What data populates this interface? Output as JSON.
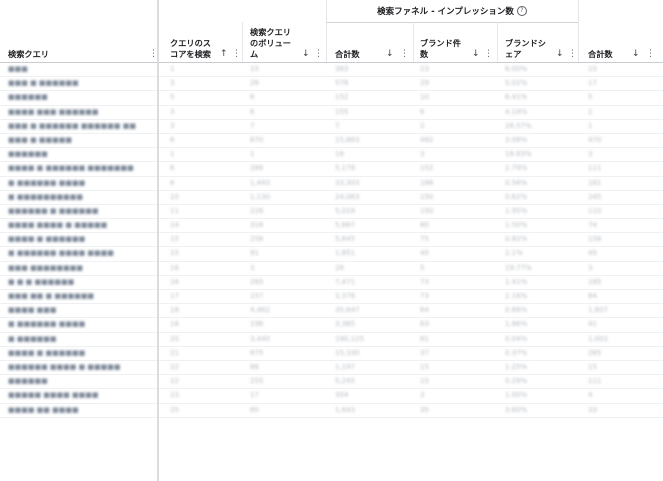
{
  "group_header": {
    "label": "検索ファネル - インプレッション数",
    "help": "?"
  },
  "columns": [
    {
      "label_lines": [
        "検索クエリ"
      ],
      "sort": "",
      "menu": "⋮"
    },
    {
      "label_lines": [
        "クエリのス",
        "コアを検索"
      ],
      "sort": "↑",
      "menu": "⋮"
    },
    {
      "label_lines": [
        "検索クエリ",
        "のボリュー",
        "ム"
      ],
      "sort": "↓",
      "menu": "⋮"
    },
    {
      "label_lines": [
        "合計数"
      ],
      "sort": "↓",
      "menu": "⋮"
    },
    {
      "label_lines": [
        "ブランド件",
        "数"
      ],
      "sort": "↓",
      "menu": "⋮"
    },
    {
      "label_lines": [
        "ブランドシ",
        "ェア"
      ],
      "sort": "↓",
      "menu": "⋮"
    },
    {
      "label_lines": [
        "合計数"
      ],
      "sort": "↓",
      "menu": "⋮"
    }
  ],
  "rows": [
    [
      "■■■",
      "1",
      "15",
      "383",
      "23",
      "6.00%",
      "15"
    ],
    [
      "■■■ ■ ■■■■■■",
      "3",
      "26",
      "578",
      "29",
      "5.02%",
      "17"
    ],
    [
      "■■■■■■",
      "5",
      "6",
      "152",
      "10",
      "6.41%",
      "5"
    ],
    [
      "■■■■ ■■■ ■■■■■■",
      "3",
      "6",
      "155",
      "6",
      "4.19%",
      "2"
    ],
    [
      "■■■ ■ ■■■■■■ ■■■■■■ ■■",
      "3",
      "7",
      "7",
      "2",
      "28.57%",
      "1"
    ],
    [
      "■■■ ■ ■■■■■",
      "6",
      "670",
      "15,663",
      "482",
      "3.08%",
      "470"
    ],
    [
      "■■■■■■",
      "1",
      "1",
      "16",
      "3",
      "18.63%",
      "3"
    ],
    [
      "■■■■ ■ ■■■■■■ ■■■■■■■",
      "6",
      "266",
      "5,178",
      "152",
      "2.79%",
      "111"
    ],
    [
      "■ ■■■■■■ ■■■■",
      "6",
      "1,493",
      "33,303",
      "188",
      "0.56%",
      "161"
    ],
    [
      "■ ■■■■■■■■■■",
      "10",
      "1,130",
      "24,063",
      "150",
      "0.62%",
      "245"
    ],
    [
      "■■■■■■ ■ ■■■■■■",
      "11",
      "226",
      "5,019",
      "150",
      "1.95%",
      "110"
    ],
    [
      "■■■■ ■■■■ ■ ■■■■■",
      "14",
      "316",
      "5,687",
      "80",
      "1.50%",
      "74"
    ],
    [
      "■■■■ ■ ■■■■■■",
      "15",
      "256",
      "5,645",
      "75",
      "0.82%",
      "158"
    ],
    [
      "■ ■■■■■■ ■■■■ ■■■■",
      "15",
      "91",
      "1,851",
      "40",
      "2.1%",
      "45"
    ],
    [
      "■■■ ■■■■■■■■",
      "16",
      "3",
      "28",
      "5",
      "19.77%",
      "3"
    ],
    [
      "■ ■ ■ ■■■■■■",
      "16",
      "265",
      "7,471",
      "73",
      "1.41%",
      "185"
    ],
    [
      "■■■ ■■ ■ ■■■■■■",
      "17",
      "157",
      "3,376",
      "73",
      "2.16%",
      "84"
    ],
    [
      "■■■■ ■■■",
      "18",
      "4,462",
      "35,647",
      "64",
      "0.66%",
      "1,607"
    ],
    [
      "■ ■■■■■■ ■■■■",
      "18",
      "196",
      "3,385",
      "63",
      "1.86%",
      "41"
    ],
    [
      "■ ■■■■■■",
      "20",
      "3,440",
      "190,125",
      "81",
      "0.04%",
      "1,002"
    ],
    [
      "■■■■ ■ ■■■■■■",
      "21",
      "675",
      "15,330",
      "37",
      "0.37%",
      "265"
    ],
    [
      "■■■■■■ ■■■■ ■ ■■■■■",
      "22",
      "86",
      "1,197",
      "15",
      "1.25%",
      "15"
    ],
    [
      "■■■■■■",
      "22",
      "255",
      "5,245",
      "15",
      "0.29%",
      "111"
    ],
    [
      "■■■■■ ■■■■ ■■■■",
      "23",
      "17",
      "304",
      "3",
      "1.00%",
      "4"
    ],
    [
      "■■■■ ■■ ■■■■",
      "25",
      "60",
      "1,643",
      "35",
      "3.60%",
      "33"
    ]
  ]
}
